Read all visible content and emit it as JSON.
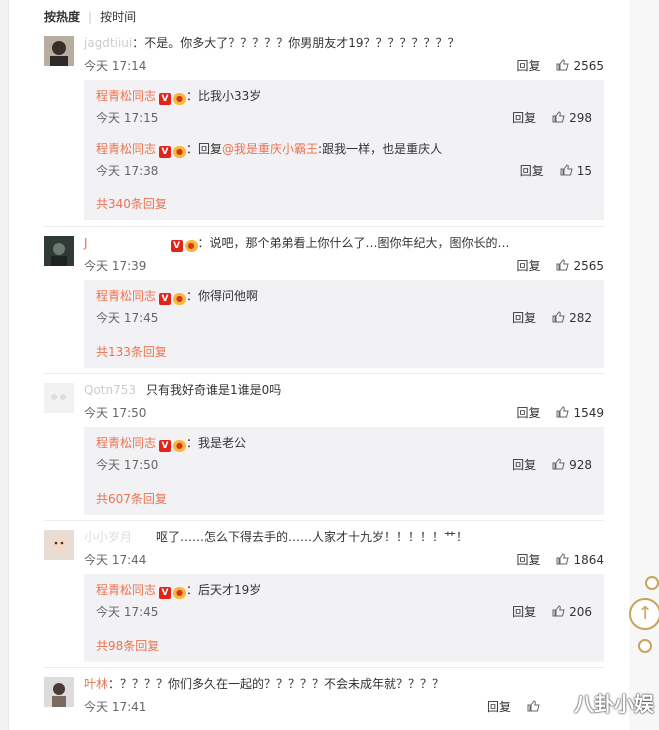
{
  "sort": {
    "hot": "按热度",
    "time": "按时间"
  },
  "colors": {
    "accent": "#eb7350",
    "subbg": "#f2f2f5"
  },
  "comments": [
    {
      "user": "jagdtiiui",
      "text": "：不是。你多大了？？？？？你男朋友才19？？？？？？？？",
      "time": "今天 17:14",
      "reply": "回复",
      "likes": "2565",
      "replies": [
        {
          "user": "程青松同志",
          "text": "：比我小33岁",
          "time": "今天 17:15",
          "reply": "回复",
          "likes": "298"
        },
        {
          "user": "程青松同志",
          "prefix": "：回复",
          "mention": "@我是重庆小霸王",
          "text": ":跟我一样，也是重庆人",
          "time": "今天 17:38",
          "reply": "回复",
          "likes": "15"
        }
      ],
      "more": "共340条回复"
    },
    {
      "user": "J",
      "text": "：说吧，那个弟弟看上你什么了…图你年纪大，图你长的…",
      "time": "今天 17:39",
      "reply": "回复",
      "likes": "2565",
      "replies": [
        {
          "user": "程青松同志",
          "text": "：你得问他啊",
          "time": "今天 17:45",
          "reply": "回复",
          "likes": "282"
        }
      ],
      "more": "共133条回复"
    },
    {
      "user": "Qotn753",
      "text": "只有我好奇谁是1谁是0吗",
      "time": "今天 17:50",
      "reply": "回复",
      "likes": "1549",
      "replies": [
        {
          "user": "程青松同志",
          "text": "：我是老公",
          "time": "今天 17:50",
          "reply": "回复",
          "likes": "928"
        }
      ],
      "more": "共607条回复"
    },
    {
      "user": "小小岁月",
      "text": "呕了……怎么下得去手的……人家才十九岁！！！！！艹！",
      "time": "今天 17:44",
      "reply": "回复",
      "likes": "1864",
      "replies": [
        {
          "user": "程青松同志",
          "text": "：后天才19岁",
          "time": "今天 17:45",
          "reply": "回复",
          "likes": "206"
        }
      ],
      "more": "共98条回复"
    },
    {
      "user": "叶林",
      "text": "：？？？？你们多久在一起的？？？？？不会未成年就？？？？",
      "time": "今天 17:41",
      "reply": "回复",
      "likes": ""
    }
  ],
  "watermark": "八卦小娱"
}
